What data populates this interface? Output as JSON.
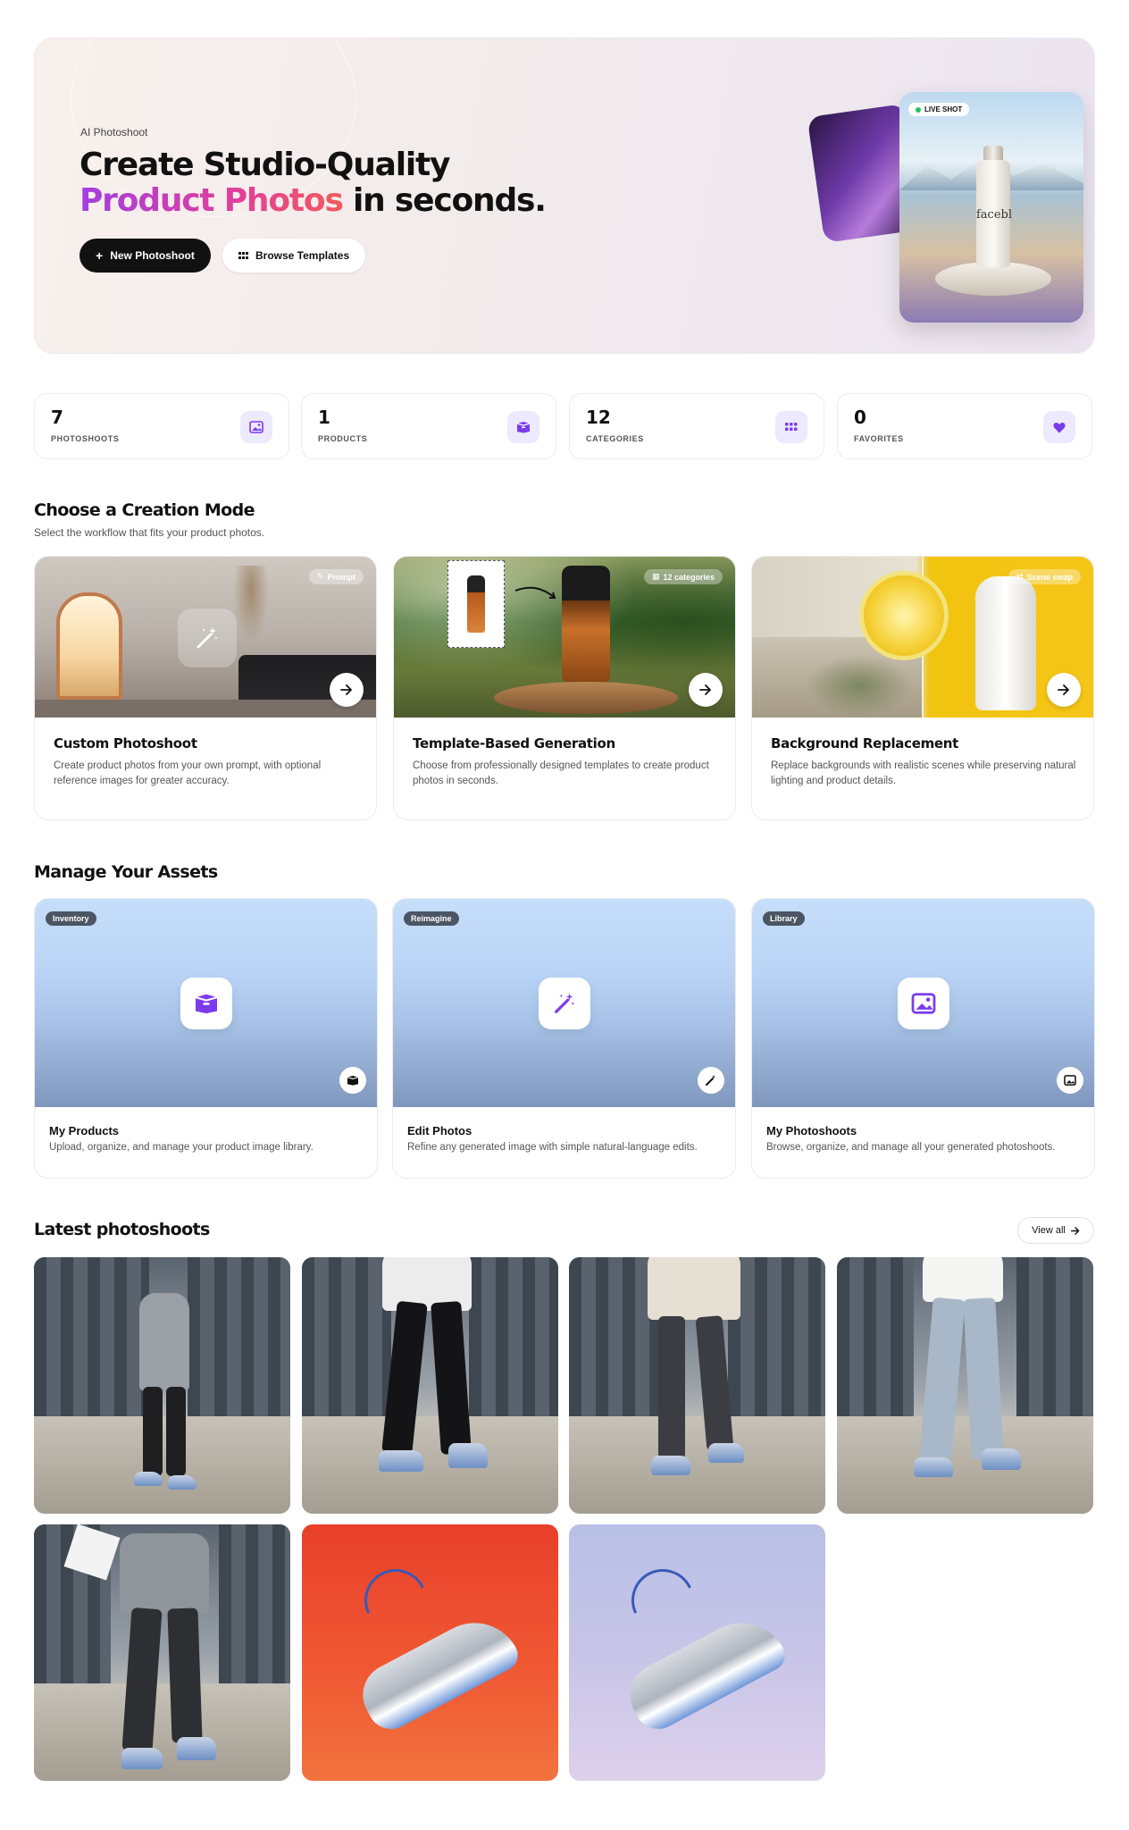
{
  "hero": {
    "eyebrow": "AI Photoshoot",
    "title_line1": "Create Studio-Quality",
    "title_gradient": "Product Photos",
    "title_rest": " in seconds.",
    "primary_button": "New Photoshoot",
    "secondary_button": "Browse Templates",
    "live_badge": "LIVE SHOT",
    "bottle_text": "facebl"
  },
  "stats": [
    {
      "value": "7",
      "label": "PHOTOSHOOTS",
      "icon": "image-icon"
    },
    {
      "value": "1",
      "label": "PRODUCTS",
      "icon": "box-icon"
    },
    {
      "value": "12",
      "label": "CATEGORIES",
      "icon": "grid-icon"
    },
    {
      "value": "0",
      "label": "FAVORITES",
      "icon": "heart-icon"
    }
  ],
  "creation": {
    "title": "Choose a Creation Mode",
    "subtitle": "Select the workflow that fits your product photos.",
    "cards": [
      {
        "chip": "Prompt",
        "title": "Custom Photoshoot",
        "desc": "Create product photos from your own prompt, with optional reference images for greater accuracy."
      },
      {
        "chip": "12 categories",
        "title": "Template-Based Generation",
        "desc": "Choose from professionally designed templates to create product photos in seconds."
      },
      {
        "chip": "Scene swap",
        "title": "Background Replacement",
        "desc": "Replace backgrounds with realistic scenes while preserving natural lighting and product details."
      }
    ]
  },
  "assets": {
    "title": "Manage Your Assets",
    "cards": [
      {
        "chip": "Inventory",
        "title": "My Products",
        "desc": "Upload, organize, and manage your product image library.",
        "icon": "box-icon"
      },
      {
        "chip": "Reimagine",
        "title": "Edit Photos",
        "desc": "Refine any generated image with simple natural-language edits.",
        "icon": "magic-wand-icon"
      },
      {
        "chip": "Library",
        "title": "My Photoshoots",
        "desc": "Browse, organize, and manage all your generated photoshoots.",
        "icon": "image-icon"
      }
    ]
  },
  "latest": {
    "title": "Latest photoshoots",
    "view_all": "View all"
  },
  "colors": {
    "accent": "#7c3aed",
    "accent_soft": "#ede9fe",
    "dark": "#111111"
  }
}
